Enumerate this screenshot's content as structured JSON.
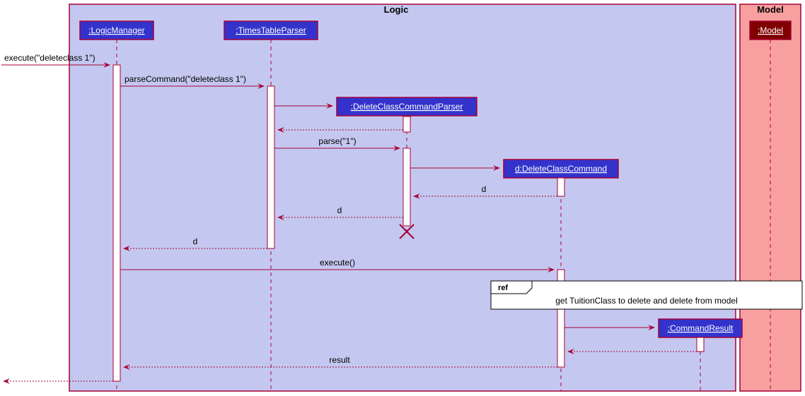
{
  "diagram": {
    "frames": {
      "logic": {
        "title": "Logic"
      },
      "model": {
        "title": "Model"
      }
    },
    "participants": {
      "logicManager": ":LogicManager",
      "timesTableParser": ":TimesTableParser",
      "deleteClassCommandParser": ":DeleteClassCommandParser",
      "deleteClassCommand": "d:DeleteClassCommand",
      "commandResult": ":CommandResult",
      "model": ":Model"
    },
    "messages": {
      "executeEntry": "execute(\"deleteclass 1\")",
      "parseCommand": "parseCommand(\"deleteclass 1\")",
      "parse": "parse(\"1\")",
      "dReturn1": "d",
      "dReturn2": "d",
      "dReturn3": "d",
      "executeCall": "execute()",
      "resultReturn": "result"
    },
    "ref": {
      "label": "ref",
      "text": "get TuitionClass to delete and delete from model"
    }
  }
}
